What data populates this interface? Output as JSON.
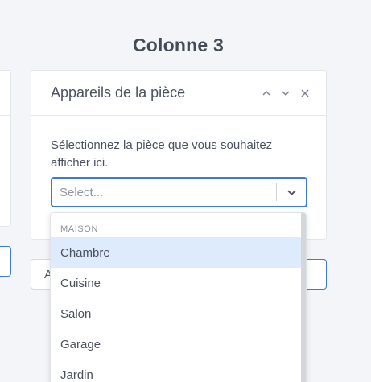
{
  "column": {
    "title": "Colonne 3"
  },
  "card": {
    "title": "Appareils de la pièce",
    "description": "Sélectionnez la pièce que vous souhaitez afficher ici."
  },
  "select": {
    "placeholder": "Select..."
  },
  "add_button": {
    "label": "A"
  },
  "menu": {
    "group_label": "Maison",
    "options": [
      {
        "label": "Chambre",
        "highlighted": true
      },
      {
        "label": "Cuisine"
      },
      {
        "label": "Salon"
      },
      {
        "label": "Garage"
      },
      {
        "label": "Jardin"
      }
    ]
  },
  "colors": {
    "accent": "#3d7ad6",
    "highlight": "#deebfc",
    "background": "#f4f5f8"
  },
  "icons": [
    "chevron-up-icon",
    "chevron-down-icon",
    "close-icon",
    "dropdown-chevron-icon"
  ]
}
